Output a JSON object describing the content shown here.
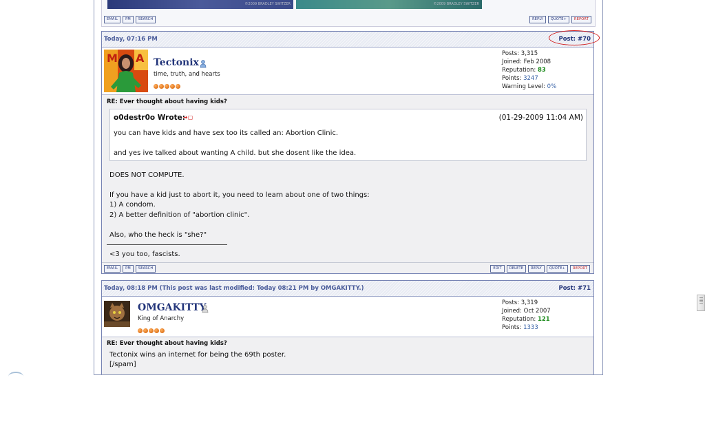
{
  "prev_post": {
    "sig_left_text": "©2009 BRADLEY SWITZER",
    "sig_right_text": "©2009 BRADLEY SWITZER",
    "buttons_left": [
      "EMAIL",
      "PM",
      "SEARCH"
    ],
    "buttons_right": [
      "REPLY",
      "QUOTE+",
      "REPORT"
    ]
  },
  "post70": {
    "date": "Today, 07:16 PM",
    "post_number": "Post: #70",
    "username": "Tectonix",
    "user_title": "time, truth, and hearts",
    "stats": {
      "posts_label": "Posts:",
      "posts": "3,315",
      "joined_label": "Joined:",
      "joined": "Feb 2008",
      "reputation_label": "Reputation:",
      "reputation": "83",
      "points_label": "Points:",
      "points": "3247",
      "warning_label": "Warning Level:",
      "warning": "0%"
    },
    "subject": "RE: Ever thought about having kids?",
    "quote": {
      "author": "o0destr0o Wrote:",
      "date": "(01-29-2009 11:04 AM)",
      "line1": "you can have kids and have sex too its called an: Abortion Clinic.",
      "line2": "and yes ive talked about wanting A child. but she dosent like the idea."
    },
    "body": [
      "DOES NOT COMPUTE.",
      "If you have a kid just to abort it, you need to learn about one of two things:",
      "1) A condom.",
      "2) A better definition of \"abortion clinic\".",
      "Also, who the heck is \"she?\""
    ],
    "signature": "<3 you too, fascists.",
    "buttons_left": [
      "EMAIL",
      "PM",
      "SEARCH"
    ],
    "buttons_right": [
      "EDIT",
      "DELETE",
      "REPLY",
      "QUOTE+",
      "REPORT"
    ]
  },
  "post71": {
    "date": "Today, 08:18 PM (This post was last modified: Today 08:21 PM by OMGAKITTY.)",
    "post_number": "Post: #71",
    "username": "OMGAKITTY",
    "user_title": "King of Anarchy",
    "stats": {
      "posts_label": "Posts:",
      "posts": "3,319",
      "joined_label": "Joined:",
      "joined": "Oct 2007",
      "reputation_label": "Reputation:",
      "reputation": "121",
      "points_label": "Points:",
      "points": "1333"
    },
    "subject": "RE: Ever thought about having kids?",
    "body": [
      "Tectonix wins an internet for being the 69th poster.",
      "[/spam]"
    ]
  },
  "colors": {
    "accent": "#23357a",
    "border": "#7784b4",
    "reputation_green": "#1a8a1a",
    "report_red": "#c01818",
    "annotation_red": "#d01818"
  }
}
